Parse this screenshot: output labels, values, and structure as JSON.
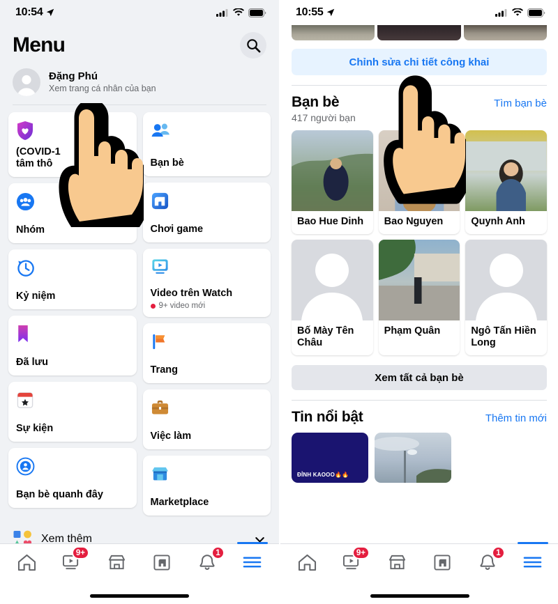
{
  "left": {
    "status": {
      "time": "10:54",
      "location_icon": "location-arrow-icon",
      "signal_icon": "cellular-signal-icon",
      "wifi_icon": "wifi-icon",
      "battery_icon": "battery-full-icon"
    },
    "header": {
      "title": "Menu",
      "search_icon": "search-icon"
    },
    "profile": {
      "name": "Đặng Phú",
      "subtitle": "Xem trang cá nhân của bạn",
      "avatar_icon": "avatar-placeholder-icon"
    },
    "menu_items": [
      {
        "label": "(COVID-19)\ntâm thông",
        "icon": "covid-shield-heart-icon",
        "column": "left"
      },
      {
        "label": "Nhóm",
        "icon": "groups-icon",
        "column": "left"
      },
      {
        "label": "Kỷ niệm",
        "icon": "memories-clock-icon",
        "column": "left"
      },
      {
        "label": "Đã lưu",
        "icon": "saved-bookmark-icon",
        "column": "left"
      },
      {
        "label": "Sự kiện",
        "icon": "events-calendar-icon",
        "column": "left"
      },
      {
        "label": "Bạn bè quanh đây",
        "icon": "nearby-friends-icon",
        "column": "left"
      },
      {
        "label": "Bạn bè",
        "icon": "friends-icon",
        "column": "right"
      },
      {
        "label": "Chơi game",
        "icon": "gaming-icon",
        "column": "right"
      },
      {
        "label": "Video trên Watch",
        "icon": "watch-video-icon",
        "column": "right",
        "sub": "9+ video mới",
        "sub_dot": true
      },
      {
        "label": "Trang",
        "icon": "pages-flag-icon",
        "column": "right"
      },
      {
        "label": "Việc làm",
        "icon": "jobs-briefcase-icon",
        "column": "right"
      },
      {
        "label": "Marketplace",
        "icon": "marketplace-icon",
        "column": "right"
      }
    ],
    "see_more": {
      "label": "Xem thêm",
      "icon": "shapes-icon",
      "chevron": "chevron-down-icon"
    },
    "nav": [
      {
        "name": "home",
        "icon": "home-icon",
        "badge": null,
        "active": false
      },
      {
        "name": "watch",
        "icon": "watch-icon",
        "badge": "9+",
        "active": false
      },
      {
        "name": "marketplace",
        "icon": "marketplace-store-icon",
        "badge": null,
        "active": false
      },
      {
        "name": "gaming",
        "icon": "gaming-icon",
        "badge": null,
        "active": false
      },
      {
        "name": "notifications",
        "icon": "bell-icon",
        "badge": "1",
        "active": false
      },
      {
        "name": "menu",
        "icon": "hamburger-menu-icon",
        "badge": null,
        "active": true
      }
    ]
  },
  "right": {
    "status": {
      "time": "10:55",
      "location_icon": "location-arrow-icon",
      "signal_icon": "cellular-signal-icon",
      "wifi_icon": "wifi-icon",
      "battery_icon": "battery-full-icon"
    },
    "edit_public": "Chỉnh sửa chi tiết công khai",
    "friends_section": {
      "title": "Bạn bè",
      "find_link": "Tìm bạn bè",
      "count": "417 người bạn",
      "see_all": "Xem tất cả bạn bè",
      "friends": [
        {
          "name": "Bao Hue Dinh",
          "has_photo": true
        },
        {
          "name": "Bao Nguyen",
          "has_photo": true
        },
        {
          "name": "Quynh Anh",
          "has_photo": true
        },
        {
          "name": "Bố Mày Tên Châu",
          "has_photo": false
        },
        {
          "name": "Phạm Quân",
          "has_photo": true
        },
        {
          "name": "Ngô Tấn Hiền Long",
          "has_photo": false
        }
      ]
    },
    "stories_section": {
      "title": "Tin nổi bật",
      "add_link": "Thêm tin mới",
      "stories": [
        {
          "caption": "ĐỈNH KAOOO🔥🔥"
        },
        {
          "caption": ""
        }
      ]
    },
    "nav": [
      {
        "name": "home",
        "icon": "home-icon",
        "badge": null,
        "active": false
      },
      {
        "name": "watch",
        "icon": "watch-icon",
        "badge": "9+",
        "active": false
      },
      {
        "name": "marketplace",
        "icon": "marketplace-store-icon",
        "badge": null,
        "active": false
      },
      {
        "name": "gaming",
        "icon": "gaming-icon",
        "badge": null,
        "active": false
      },
      {
        "name": "notifications",
        "icon": "bell-icon",
        "badge": "1",
        "active": false
      },
      {
        "name": "menu",
        "icon": "hamburger-menu-icon",
        "badge": null,
        "active": true
      }
    ]
  },
  "colors": {
    "accent": "#1877f2",
    "badge_red": "#e41e3f",
    "bg": "#f0f2f5",
    "card": "#ffffff",
    "muted": "#65676b"
  }
}
